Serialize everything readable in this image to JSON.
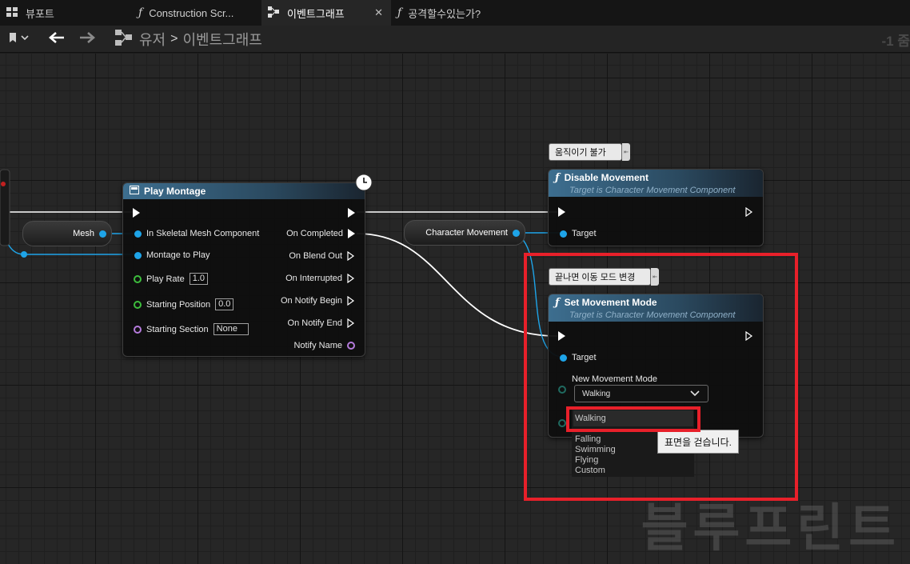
{
  "tabs": [
    {
      "label": "뷰포트",
      "icon": "grid-icon"
    },
    {
      "label": "Construction Scr...",
      "icon": "function-icon"
    },
    {
      "label": "이벤트그래프",
      "icon": "graph-icon",
      "active": true
    },
    {
      "label": "공격할수있는가?",
      "icon": "function-icon"
    }
  ],
  "toolbar": {
    "breadcrumb_root": "유저",
    "breadcrumb_separator": ">",
    "breadcrumb_current": "이벤트그래프",
    "zoom": "-1 줌"
  },
  "nodes": {
    "play_montage": {
      "title": "Play Montage",
      "in_skeletal": "In Skeletal Mesh Component",
      "montage_to_play": "Montage to Play",
      "play_rate": "Play Rate",
      "play_rate_value": "1.0",
      "starting_position": "Starting Position",
      "starting_position_value": "0.0",
      "starting_section": "Starting Section",
      "starting_section_value": "None",
      "on_completed": "On Completed",
      "on_blend_out": "On Blend Out",
      "on_interrupted": "On Interrupted",
      "on_notify_begin": "On Notify Begin",
      "on_notify_end": "On Notify End",
      "notify_name": "Notify Name"
    },
    "mesh_var": {
      "label": "Mesh"
    },
    "character_movement_var": {
      "label": "Character Movement"
    },
    "disable_movement": {
      "comment": "움직이기 불가",
      "title": "Disable Movement",
      "subtitle": "Target is Character Movement Component",
      "target": "Target"
    },
    "set_movement_mode": {
      "comment": "끝나면 이동 모드 변경",
      "title": "Set Movement Mode",
      "subtitle": "Target is Character Movement Component",
      "target": "Target",
      "new_movement_mode": "New Movement Mode",
      "selected": "Walking"
    }
  },
  "dropdown_menu": {
    "options": [
      "Walking",
      "Falling",
      "Swimming",
      "Flying",
      "Custom"
    ],
    "highlighted": "Walking",
    "tooltip": "표면을 걷습니다."
  },
  "watermark": "블루프린트",
  "colors": {
    "exec": "#ffffff",
    "object_pin": "#1ea4e8",
    "float_pin": "#3dbd3d",
    "name_pin": "#b57bdc",
    "highlight": "#e8202a",
    "node_header": "#3d6e8f"
  }
}
